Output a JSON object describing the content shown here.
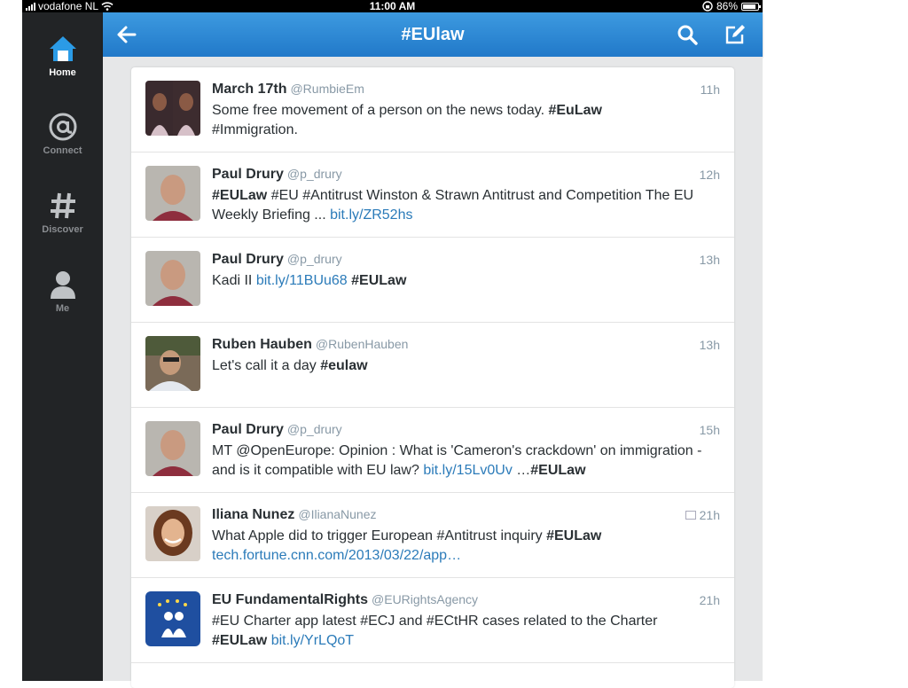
{
  "status": {
    "carrier": "vodafone NL",
    "time": "11:00 AM",
    "battery": "86%"
  },
  "nav": {
    "items": [
      {
        "label": "Home",
        "icon": "home-icon",
        "active": true
      },
      {
        "label": "Connect",
        "icon": "at-icon",
        "active": false
      },
      {
        "label": "Discover",
        "icon": "hash-icon",
        "active": false
      },
      {
        "label": "Me",
        "icon": "person-icon",
        "active": false
      }
    ]
  },
  "header": {
    "title": "#EUlaw",
    "back_icon": "back-arrow-icon",
    "search_icon": "search-icon",
    "compose_icon": "compose-icon"
  },
  "colors": {
    "header": "#2b86d4",
    "sidebar": "#222426",
    "link": "#2b7bb9",
    "muted": "#8899a6"
  },
  "tweets": [
    {
      "name": "March 17th",
      "handle": "@RumbieEm",
      "time": "11h",
      "parts": [
        [
          "t",
          "Some free movement of a person on the news today. "
        ],
        [
          "tag",
          "#EuLaw"
        ],
        [
          "t",
          "\n#Immigration."
        ]
      ]
    },
    {
      "name": "Paul Drury",
      "handle": "@p_drury",
      "time": "12h",
      "parts": [
        [
          "tag",
          "#EULaw"
        ],
        [
          "t",
          " #EU #Antitrust Winston & Strawn Antitrust and Competition The EU Weekly Briefing ... "
        ],
        [
          "link",
          "bit.ly/ZR52hs"
        ]
      ]
    },
    {
      "name": "Paul Drury",
      "handle": "@p_drury",
      "time": "13h",
      "parts": [
        [
          "t",
          "Kadi II "
        ],
        [
          "link",
          "bit.ly/11BUu68"
        ],
        [
          "t",
          " "
        ],
        [
          "tag",
          "#EULaw"
        ]
      ]
    },
    {
      "name": "Ruben Hauben",
      "handle": "@RubenHauben",
      "time": "13h",
      "parts": [
        [
          "t",
          "Let's call it a day "
        ],
        [
          "tag",
          "#eulaw"
        ]
      ]
    },
    {
      "name": "Paul Drury",
      "handle": "@p_drury",
      "time": "15h",
      "parts": [
        [
          "t",
          "MT @OpenEurope: Opinion : What is 'Cameron's crackdown' on immigration - and is it compatible with EU law? "
        ],
        [
          "link",
          "bit.ly/15Lv0Uv"
        ],
        [
          "t",
          " …"
        ],
        [
          "tag",
          "#EULaw"
        ]
      ]
    },
    {
      "name": "Iliana Nunez",
      "handle": "@IlianaNunez",
      "time": "21h",
      "photo": true,
      "parts": [
        [
          "t",
          "What Apple did to trigger European #Antitrust inquiry "
        ],
        [
          "tag",
          "#EULaw"
        ],
        [
          "t",
          "\n"
        ],
        [
          "link",
          "tech.fortune.cnn.com/2013/03/22/app…"
        ]
      ]
    },
    {
      "name": "EU FundamentalRights",
      "handle": "@EURightsAgency",
      "time": "21h",
      "parts": [
        [
          "t",
          "#EU Charter app latest #ECJ and #ECtHR cases related to the Charter\n"
        ],
        [
          "tag",
          "#EULaw"
        ],
        [
          "t",
          " "
        ],
        [
          "link",
          "bit.ly/YrLQoT"
        ]
      ]
    }
  ]
}
